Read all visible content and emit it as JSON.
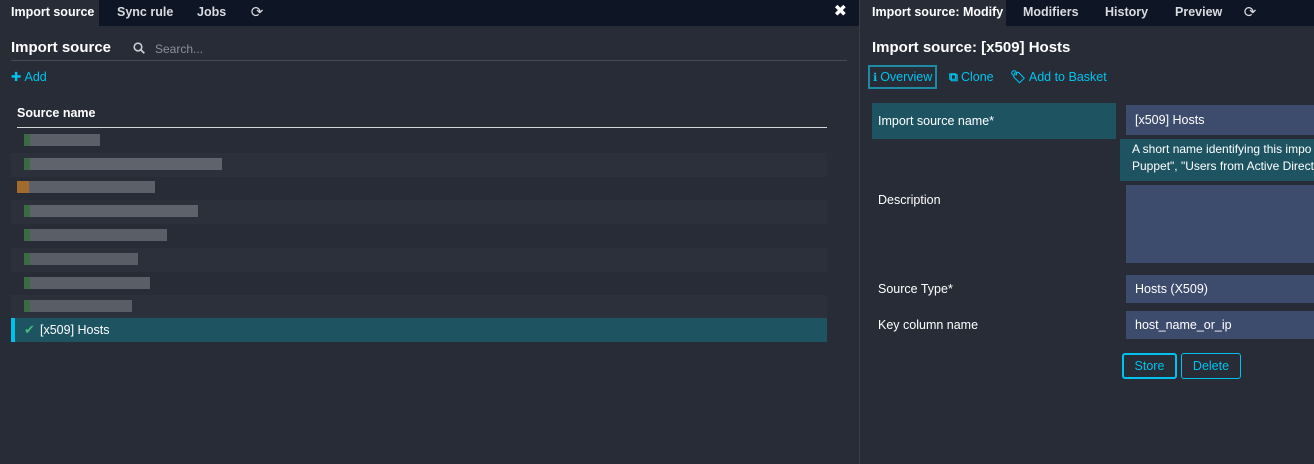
{
  "left": {
    "tabs": [
      {
        "label": "Import source",
        "active": true
      },
      {
        "label": "Sync rule",
        "active": false
      },
      {
        "label": "Jobs",
        "active": false
      }
    ],
    "refresh_icon": "refresh-icon",
    "close_icon": "close-icon",
    "title": "Import source",
    "search": {
      "placeholder": "Search..."
    },
    "add_label": "Add",
    "table": {
      "header": "Source name",
      "rows": [
        {
          "label": "",
          "blurred": true,
          "color": "#3b6a44"
        },
        {
          "label": "",
          "blurred": true,
          "color": "#3b6a44"
        },
        {
          "label": "",
          "blurred": true,
          "color": "#a36a2e"
        },
        {
          "label": "",
          "blurred": true,
          "color": "#3b6a44"
        },
        {
          "label": "",
          "blurred": true,
          "color": "#3b6a44"
        },
        {
          "label": "",
          "blurred": true,
          "color": "#3b6a44"
        },
        {
          "label": "",
          "blurred": true,
          "color": "#3b6a44"
        },
        {
          "label": "",
          "blurred": true,
          "color": "#3b6a44"
        },
        {
          "label": "[x509] Hosts",
          "blurred": false,
          "selected": true
        }
      ]
    }
  },
  "right": {
    "tabs": [
      {
        "label": "Import source: Modify",
        "active": true
      },
      {
        "label": "Modifiers",
        "active": false
      },
      {
        "label": "History",
        "active": false
      },
      {
        "label": "Preview",
        "active": false
      }
    ],
    "refresh_icon": "refresh-icon",
    "title": "Import source: [x509] Hosts",
    "actions": {
      "overview": "Overview",
      "clone": "Clone",
      "basket": "Add to Basket"
    },
    "form": {
      "name_label": "Import source name*",
      "name_value": "[x509] Hosts",
      "name_hint_line1": "A short name identifying this impo",
      "name_hint_line2": "Puppet\", \"Users from Active Directo",
      "description_label": "Description",
      "description_value": "",
      "source_type_label": "Source Type*",
      "source_type_value": "Hosts (X509)",
      "key_column_label": "Key column name",
      "key_column_value": "host_name_or_ip"
    },
    "buttons": {
      "store": "Store",
      "delete": "Delete"
    }
  },
  "colors": {
    "accent": "#00c3ed",
    "selected_row": "#1e5462",
    "tabbar": "#0e1524",
    "input_bg": "#3d4b6c"
  }
}
